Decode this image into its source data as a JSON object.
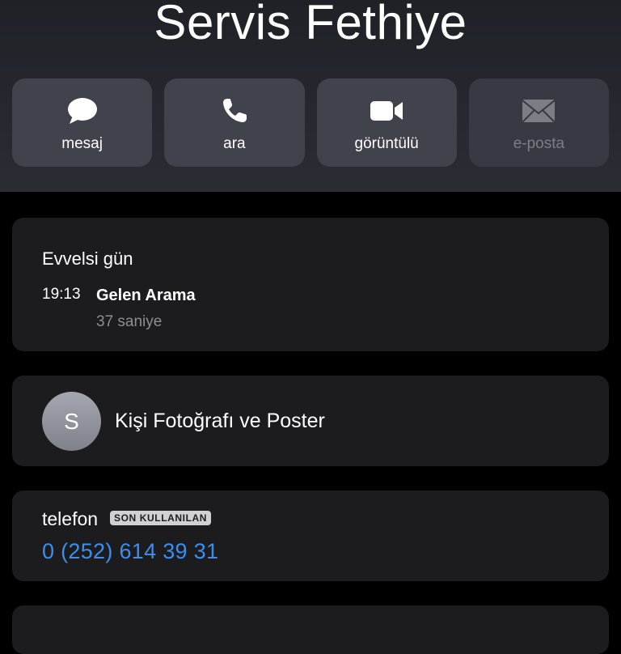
{
  "contact": {
    "name": "Servis Fethiye"
  },
  "actions": [
    {
      "label": "mesaj",
      "icon": "message-bubble-icon",
      "enabled": true
    },
    {
      "label": "ara",
      "icon": "phone-icon",
      "enabled": true
    },
    {
      "label": "görüntülü",
      "icon": "video-camera-icon",
      "enabled": true
    },
    {
      "label": "e-posta",
      "icon": "envelope-icon",
      "enabled": false
    }
  ],
  "call_history": {
    "date": "Evvelsi gün",
    "time": "19:13",
    "type": "Gelen Arama",
    "duration": "37 saniye"
  },
  "photo_poster": {
    "avatar_initial": "S",
    "label": "Kişi Fotoğrafı ve Poster"
  },
  "phone": {
    "label": "telefon",
    "badge": "SON KULLANILAN",
    "number": "0 (252) 614 39 31"
  },
  "colors": {
    "background": "#000000",
    "card": "#1c1c1e",
    "action_button": "#40424c",
    "link_blue": "#3a8ff0",
    "secondary_text": "#8e8e93"
  }
}
